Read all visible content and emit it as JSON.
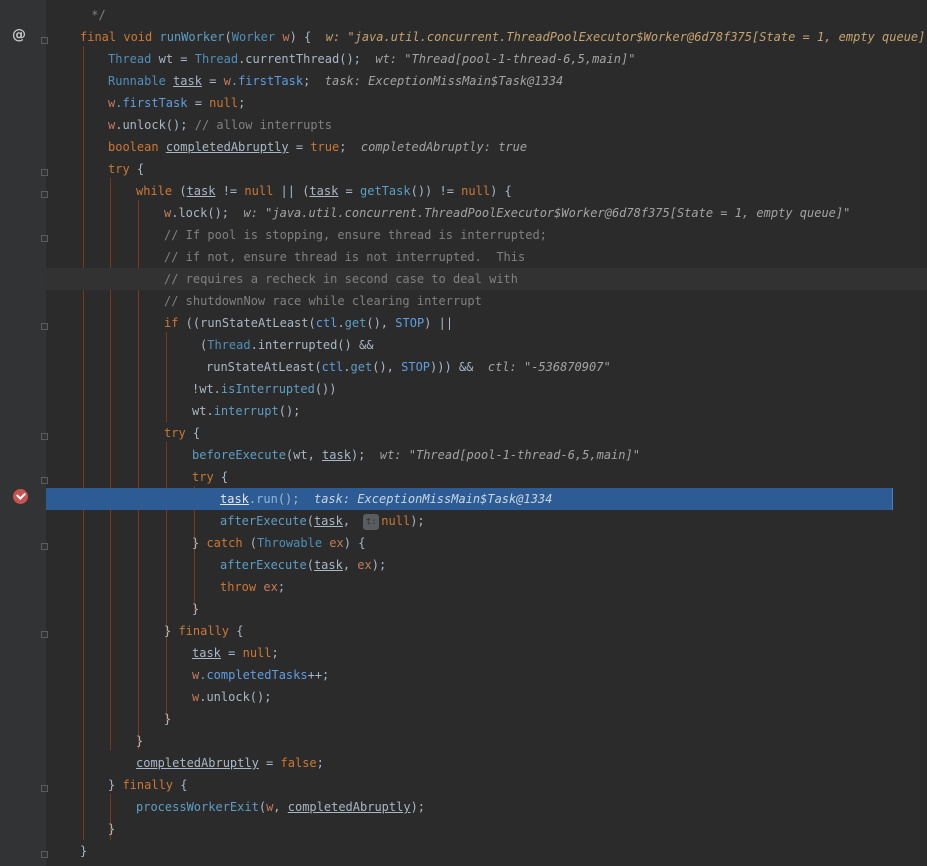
{
  "colors": {
    "background": "#2b2b2b",
    "gutter": "#313335",
    "keyword": "#cc7832",
    "comment": "#808080",
    "execution_line": "#2d5c94",
    "breakpoint": "#c75450"
  },
  "gutter_icons": {
    "override": "@",
    "breakpoint": "breakpoint-icon"
  },
  "code": {
    "l1": {
      "t": " */"
    },
    "l2": {
      "a": "final",
      "b": "void",
      "c": "runWorker",
      "d": "(",
      "e": "Worker",
      "f": "w",
      "g": ") {",
      "h": "w: \"java.util.concurrent.ThreadPoolExecutor$Worker@6d78f375[State = 1, empty queue]\""
    },
    "l3": {
      "a": "Thread",
      "b": "wt = ",
      "c": "Thread",
      "d": ".currentThread();",
      "e": "wt: \"Thread[pool-1-thread-6,5,main]\""
    },
    "l4": {
      "a": "Runnable",
      "b": "task",
      "c": " = ",
      "d": "w",
      "e": ".firstTask",
      "f": ";",
      "g": "task: ExceptionMissMain$Task@1334"
    },
    "l5": {
      "a": "w",
      "b": ".firstTask",
      "c": " = ",
      "d": "null",
      "e": ";"
    },
    "l6": {
      "a": "w",
      "b": ".unlock();",
      "c": "// allow interrupts"
    },
    "l7": {
      "a": "boolean",
      "b": "completedAbruptly",
      "c": " = ",
      "d": "true",
      "e": ";",
      "f": "completedAbruptly: true"
    },
    "l8": {
      "a": "try",
      "b": " {"
    },
    "l9": {
      "a": "while",
      "b": " (",
      "c": "task",
      "d": " != ",
      "e": "null",
      "f": " || (",
      "g": "task",
      "h": " = ",
      "i": "getTask",
      "j": "()) != ",
      "k": "null",
      "m": ") {"
    },
    "l10": {
      "a": "w",
      "b": ".lock();",
      "c": "w: \"java.util.concurrent.ThreadPoolExecutor$Worker@6d78f375[State = 1, empty queue]\""
    },
    "l11": {
      "t": "// If pool is stopping, ensure thread is interrupted;"
    },
    "l12": {
      "t": "// if not, ensure thread is not interrupted.  This"
    },
    "l13": {
      "t": "// requires a recheck in second case to deal with"
    },
    "l14": {
      "t": "// shutdownNow race while clearing interrupt"
    },
    "l15": {
      "a": "if",
      "b": " ((",
      "c": "runStateAtLeast",
      "d": "(",
      "e": "ctl",
      "f": ".",
      "g": "get",
      "h": "(), ",
      "i": "STOP",
      "j": ") ||"
    },
    "l16": {
      "a": "(",
      "b": "Thread",
      "c": ".interrupted() &&"
    },
    "l17": {
      "a": "runStateAtLeast",
      "b": "(",
      "c": "ctl",
      "d": ".",
      "e": "get",
      "f": "(), ",
      "g": "STOP",
      "h": "))) &&",
      "i": "ctl: \"-536870907\""
    },
    "l18": {
      "a": "!wt.",
      "b": "isInterrupted",
      "c": "())"
    },
    "l19": {
      "a": "wt.",
      "b": "interrupt",
      "c": "();"
    },
    "l20": {
      "a": "try",
      "b": " {"
    },
    "l21": {
      "a": "beforeExecute",
      "b": "(wt, ",
      "c": "task",
      "d": ");",
      "e": "wt: \"Thread[pool-1-thread-6,5,main]\""
    },
    "l22": {
      "a": "try",
      "b": " {"
    },
    "l23": {
      "a": "task",
      "b": ".",
      "c": "run",
      "d": "();",
      "e": "task: ExceptionMissMain$Task@1334"
    },
    "l24": {
      "a": "afterExecute",
      "b": "(",
      "c": "task",
      "d": ", ",
      "e": "t:",
      "f": "null",
      "g": ");"
    },
    "l25": {
      "a": "} ",
      "b": "catch",
      "c": " (",
      "d": "Throwable",
      "e": "ex",
      "f": ") {"
    },
    "l26": {
      "a": "afterExecute",
      "b": "(",
      "c": "task",
      "d": ", ",
      "e": "ex",
      "f": ");"
    },
    "l27": {
      "a": "throw",
      "b": "ex",
      "c": ";"
    },
    "l28": {
      "t": "}"
    },
    "l29": {
      "a": "} ",
      "b": "finally",
      "c": " {"
    },
    "l30": {
      "a": "task",
      "b": " = ",
      "c": "null",
      "d": ";"
    },
    "l31": {
      "a": "w",
      "b": ".completedTasks",
      "c": "++;"
    },
    "l32": {
      "a": "w",
      "b": ".unlock();"
    },
    "l33": {
      "t": "}"
    },
    "l34": {
      "t": "}"
    },
    "l35": {
      "a": "completedAbruptly",
      "b": " = ",
      "c": "false",
      "d": ";"
    },
    "l36": {
      "a": "} ",
      "b": "finally",
      "c": " {"
    },
    "l37": {
      "a": "processWorkerExit",
      "b": "(",
      "c": "w",
      "d": ", ",
      "e": "completedAbruptly",
      "f": ");"
    },
    "l38": {
      "t": "}"
    },
    "l39": {
      "t": "}"
    }
  }
}
